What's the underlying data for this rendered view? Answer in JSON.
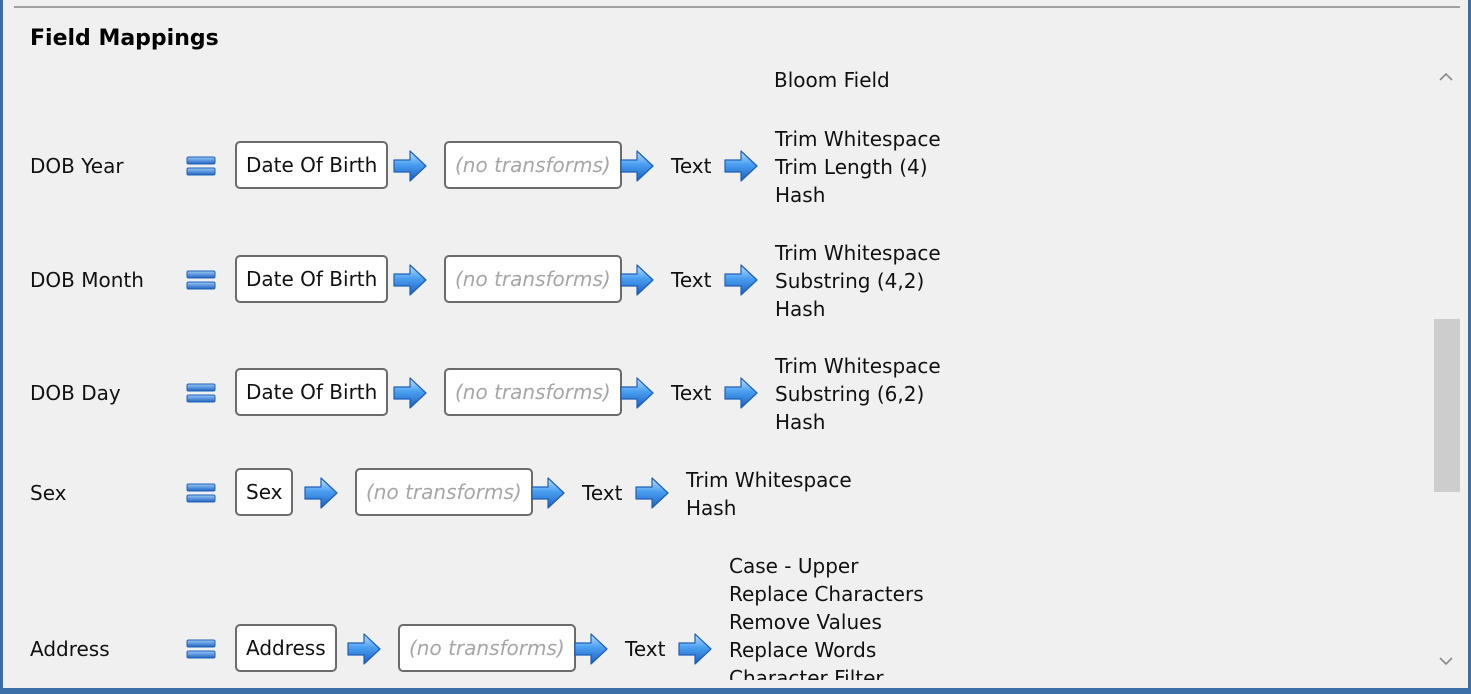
{
  "section_title": "Field Mappings",
  "column_header": "Bloom Field",
  "colors": {
    "window_border": "#3c6fa8",
    "panel_bg": "#f0f0f0",
    "arrow_blue": "#2f84dd",
    "placeholder_text": "#a6a6a6"
  },
  "icons": {
    "equals": "equals-icon",
    "arrow": "arrow-right-icon",
    "scroll_up": "chevron-up-icon",
    "scroll_down": "chevron-down-icon"
  },
  "mappings": [
    {
      "label": "DOB Year",
      "source": "Date Of Birth",
      "transforms": "(no transforms)",
      "type": "Text",
      "steps": [
        "Trim Whitespace",
        "Trim Length (4)",
        "Hash"
      ]
    },
    {
      "label": "DOB Month",
      "source": "Date Of Birth",
      "transforms": "(no transforms)",
      "type": "Text",
      "steps": [
        "Trim Whitespace",
        "Substring (4,2)",
        "Hash"
      ]
    },
    {
      "label": "DOB Day",
      "source": "Date Of Birth",
      "transforms": "(no transforms)",
      "type": "Text",
      "steps": [
        "Trim Whitespace",
        "Substring (6,2)",
        "Hash"
      ]
    },
    {
      "label": "Sex",
      "source": "Sex",
      "transforms": "(no transforms)",
      "type": "Text",
      "steps": [
        "Trim Whitespace",
        "Hash"
      ]
    },
    {
      "label": "Address",
      "source": "Address",
      "transforms": "(no transforms)",
      "type": "Text",
      "steps": [
        "Case - Upper",
        "Replace Characters",
        "Remove Values",
        "Replace Words",
        "Character Filter"
      ]
    }
  ]
}
